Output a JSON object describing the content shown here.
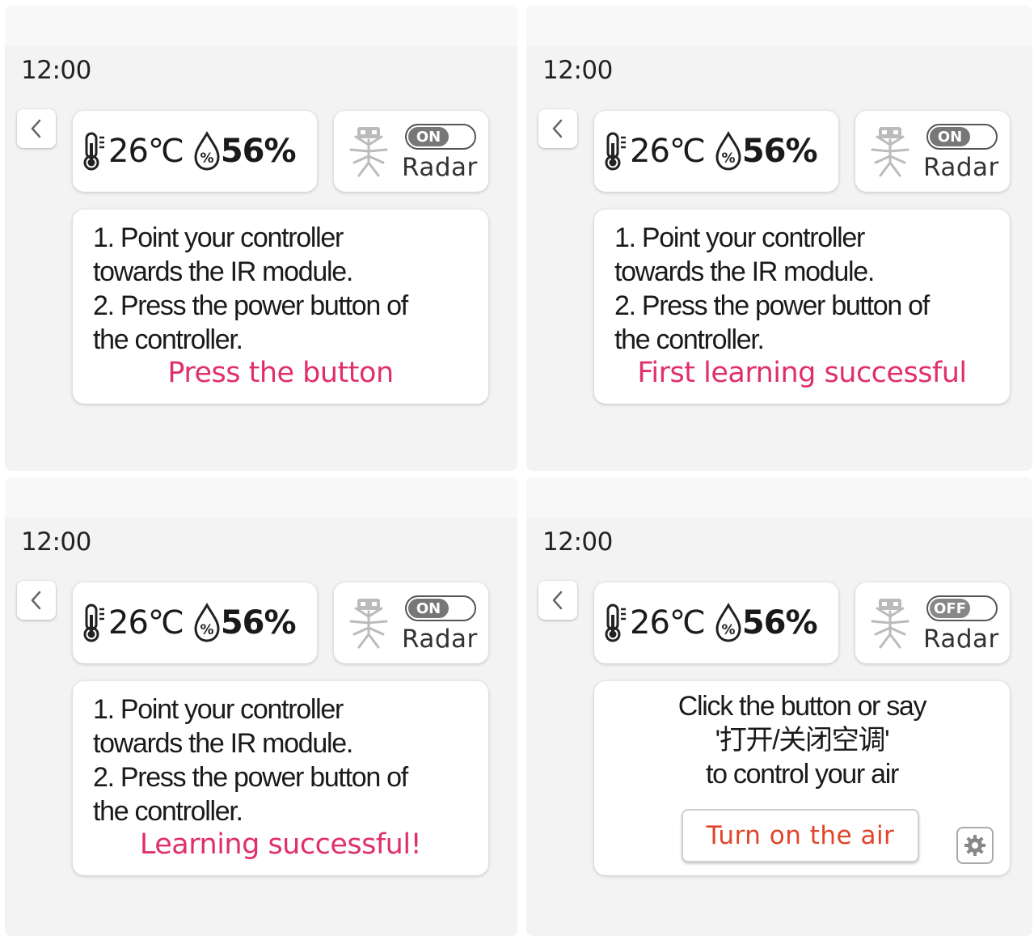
{
  "screens": [
    {
      "time": "12:00",
      "temperature": "26℃",
      "humidity": "56%",
      "radar": {
        "toggle_label": "ON",
        "label": "Radar"
      },
      "message": {
        "steps": [
          "1. Point your controller",
          "towards the IR module.",
          "2. Press the power button of",
          "the controller."
        ],
        "status": "Press the button"
      }
    },
    {
      "time": "12:00",
      "temperature": "26℃",
      "humidity": "56%",
      "radar": {
        "toggle_label": "ON",
        "label": "Radar"
      },
      "message": {
        "steps": [
          "1. Point your controller",
          "towards the IR module.",
          "2. Press the power button of",
          "the controller."
        ],
        "status": "First learning successful"
      }
    },
    {
      "time": "12:00",
      "temperature": "26℃",
      "humidity": "56%",
      "radar": {
        "toggle_label": "ON",
        "label": "Radar"
      },
      "message": {
        "steps": [
          "1. Point your controller",
          "towards the IR module.",
          "2. Press the power button of",
          "the controller."
        ],
        "status": "Learning successful!"
      }
    },
    {
      "time": "12:00",
      "temperature": "26℃",
      "humidity": "56%",
      "radar": {
        "toggle_label": "OFF",
        "label": "Radar"
      },
      "voice": {
        "lines": [
          "Click the button or say",
          "'打开/关闭空调'",
          "to control your air"
        ],
        "button_label": "Turn on the air"
      }
    }
  ],
  "colors": {
    "status_text": "#e0306a",
    "button_text": "#e0452a",
    "panel_bg": "#f3f3f3",
    "card_bg": "#ffffff"
  },
  "icons": [
    "chevron-left-icon",
    "thermometer-icon",
    "humidity-drop-icon",
    "radar-robot-icon",
    "gear-icon"
  ]
}
